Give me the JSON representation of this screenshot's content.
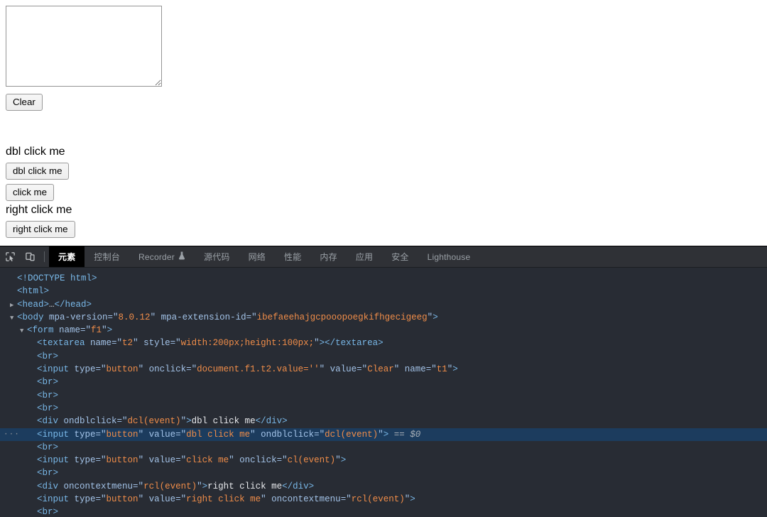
{
  "page": {
    "textarea": {
      "value": "",
      "placeholder": ""
    },
    "clear_button_label": "Clear",
    "dbl_click_text": "dbl click me",
    "dbl_click_button_label": "dbl click me",
    "click_button_label": "click me",
    "right_click_text": "right click me",
    "right_click_button_label": "right click me"
  },
  "devtools": {
    "icons": {
      "inspect": "inspect-element-icon",
      "device": "device-toolbar-icon"
    },
    "tabs": [
      {
        "label": "元素",
        "active": true,
        "icon": null
      },
      {
        "label": "控制台",
        "active": false,
        "icon": null
      },
      {
        "label": "Recorder",
        "active": false,
        "icon": "flask-icon"
      },
      {
        "label": "源代码",
        "active": false,
        "icon": null
      },
      {
        "label": "网络",
        "active": false,
        "icon": null
      },
      {
        "label": "性能",
        "active": false,
        "icon": null
      },
      {
        "label": "内存",
        "active": false,
        "icon": null
      },
      {
        "label": "应用",
        "active": false,
        "icon": null
      },
      {
        "label": "安全",
        "active": false,
        "icon": null
      },
      {
        "label": "Lighthouse",
        "active": false,
        "icon": null
      }
    ],
    "colors": {
      "panel_bg": "#282c34",
      "toolbar_bg": "#2f3136",
      "active_tab_bg": "#000000",
      "selected_row_bg": "#1c3c5e",
      "tag": "#79b8e8",
      "attr_name": "#a3c3e8",
      "attr_value": "#f08d49",
      "text_node": "#e8eaed"
    },
    "dom_lines": [
      {
        "indent": 0,
        "triangle": "none",
        "selected": false,
        "parts": [
          {
            "t": "tag",
            "s": "<!DOCTYPE html>"
          }
        ]
      },
      {
        "indent": 0,
        "triangle": "none",
        "selected": false,
        "parts": [
          {
            "t": "tag",
            "s": "<html>"
          }
        ]
      },
      {
        "indent": 0,
        "triangle": "collapsed",
        "selected": false,
        "parts": [
          {
            "t": "tag",
            "s": "<head>"
          },
          {
            "t": "dots",
            "s": "…"
          },
          {
            "t": "tag",
            "s": "</head>"
          }
        ]
      },
      {
        "indent": 0,
        "triangle": "expanded",
        "selected": false,
        "parts": [
          {
            "t": "tag",
            "s": "<body"
          },
          {
            "t": "attr",
            "s": " mpa-version"
          },
          {
            "t": "punc",
            "s": "=\""
          },
          {
            "t": "val",
            "s": "8.0.12"
          },
          {
            "t": "punc",
            "s": "\""
          },
          {
            "t": "attr",
            "s": " mpa-extension-id"
          },
          {
            "t": "punc",
            "s": "=\""
          },
          {
            "t": "val",
            "s": "ibefaeehajgcpooopoegkifhgecigeeg"
          },
          {
            "t": "punc",
            "s": "\""
          },
          {
            "t": "tag",
            "s": ">"
          }
        ]
      },
      {
        "indent": 1,
        "triangle": "expanded",
        "selected": false,
        "parts": [
          {
            "t": "tag",
            "s": "<form"
          },
          {
            "t": "attr",
            "s": " name"
          },
          {
            "t": "punc",
            "s": "=\""
          },
          {
            "t": "val",
            "s": "f1"
          },
          {
            "t": "punc",
            "s": "\""
          },
          {
            "t": "tag",
            "s": ">"
          }
        ]
      },
      {
        "indent": 2,
        "triangle": "none",
        "selected": false,
        "parts": [
          {
            "t": "tag",
            "s": "<textarea"
          },
          {
            "t": "attr",
            "s": " name"
          },
          {
            "t": "punc",
            "s": "=\""
          },
          {
            "t": "val",
            "s": "t2"
          },
          {
            "t": "punc",
            "s": "\""
          },
          {
            "t": "attr",
            "s": " style"
          },
          {
            "t": "punc",
            "s": "=\""
          },
          {
            "t": "val",
            "s": "width:200px;height:100px;"
          },
          {
            "t": "punc",
            "s": "\""
          },
          {
            "t": "tag",
            "s": "></textarea>"
          }
        ]
      },
      {
        "indent": 2,
        "triangle": "none",
        "selected": false,
        "parts": [
          {
            "t": "tag",
            "s": "<br>"
          }
        ]
      },
      {
        "indent": 2,
        "triangle": "none",
        "selected": false,
        "parts": [
          {
            "t": "tag",
            "s": "<input"
          },
          {
            "t": "attr",
            "s": " type"
          },
          {
            "t": "punc",
            "s": "=\""
          },
          {
            "t": "val",
            "s": "button"
          },
          {
            "t": "punc",
            "s": "\""
          },
          {
            "t": "attr",
            "s": " onclick"
          },
          {
            "t": "punc",
            "s": "=\""
          },
          {
            "t": "val",
            "s": "document.f1.t2.value=''"
          },
          {
            "t": "punc",
            "s": "\""
          },
          {
            "t": "attr",
            "s": " value"
          },
          {
            "t": "punc",
            "s": "=\""
          },
          {
            "t": "val",
            "s": "Clear"
          },
          {
            "t": "punc",
            "s": "\""
          },
          {
            "t": "attr",
            "s": " name"
          },
          {
            "t": "punc",
            "s": "=\""
          },
          {
            "t": "val",
            "s": "t1"
          },
          {
            "t": "punc",
            "s": "\""
          },
          {
            "t": "tag",
            "s": ">"
          }
        ]
      },
      {
        "indent": 2,
        "triangle": "none",
        "selected": false,
        "parts": [
          {
            "t": "tag",
            "s": "<br>"
          }
        ]
      },
      {
        "indent": 2,
        "triangle": "none",
        "selected": false,
        "parts": [
          {
            "t": "tag",
            "s": "<br>"
          }
        ]
      },
      {
        "indent": 2,
        "triangle": "none",
        "selected": false,
        "parts": [
          {
            "t": "tag",
            "s": "<br>"
          }
        ]
      },
      {
        "indent": 2,
        "triangle": "none",
        "selected": false,
        "parts": [
          {
            "t": "tag",
            "s": "<div"
          },
          {
            "t": "attr",
            "s": " ondblclick"
          },
          {
            "t": "punc",
            "s": "=\""
          },
          {
            "t": "val",
            "s": "dcl(event)"
          },
          {
            "t": "punc",
            "s": "\""
          },
          {
            "t": "tag",
            "s": ">"
          },
          {
            "t": "txt",
            "s": "dbl click me"
          },
          {
            "t": "tag",
            "s": "</div>"
          }
        ]
      },
      {
        "indent": 2,
        "triangle": "none",
        "selected": true,
        "badge": "···",
        "parts": [
          {
            "t": "tag",
            "s": "<input"
          },
          {
            "t": "attr",
            "s": " type"
          },
          {
            "t": "punc",
            "s": "=\""
          },
          {
            "t": "val",
            "s": "button"
          },
          {
            "t": "punc",
            "s": "\""
          },
          {
            "t": "attr",
            "s": " value"
          },
          {
            "t": "punc",
            "s": "=\""
          },
          {
            "t": "val",
            "s": "dbl click me"
          },
          {
            "t": "punc",
            "s": "\""
          },
          {
            "t": "attr",
            "s": " ondblclick"
          },
          {
            "t": "punc",
            "s": "=\""
          },
          {
            "t": "val",
            "s": "dcl(event)"
          },
          {
            "t": "punc",
            "s": "\""
          },
          {
            "t": "tag",
            "s": ">"
          },
          {
            "t": "eqeq",
            "s": " == "
          },
          {
            "t": "dollr",
            "s": "$0"
          }
        ]
      },
      {
        "indent": 2,
        "triangle": "none",
        "selected": false,
        "parts": [
          {
            "t": "tag",
            "s": "<br>"
          }
        ]
      },
      {
        "indent": 2,
        "triangle": "none",
        "selected": false,
        "parts": [
          {
            "t": "tag",
            "s": "<input"
          },
          {
            "t": "attr",
            "s": " type"
          },
          {
            "t": "punc",
            "s": "=\""
          },
          {
            "t": "val",
            "s": "button"
          },
          {
            "t": "punc",
            "s": "\""
          },
          {
            "t": "attr",
            "s": " value"
          },
          {
            "t": "punc",
            "s": "=\""
          },
          {
            "t": "val",
            "s": "click me"
          },
          {
            "t": "punc",
            "s": "\""
          },
          {
            "t": "attr",
            "s": " onclick"
          },
          {
            "t": "punc",
            "s": "=\""
          },
          {
            "t": "val",
            "s": "cl(event)"
          },
          {
            "t": "punc",
            "s": "\""
          },
          {
            "t": "tag",
            "s": ">"
          }
        ]
      },
      {
        "indent": 2,
        "triangle": "none",
        "selected": false,
        "parts": [
          {
            "t": "tag",
            "s": "<br>"
          }
        ]
      },
      {
        "indent": 2,
        "triangle": "none",
        "selected": false,
        "parts": [
          {
            "t": "tag",
            "s": "<div"
          },
          {
            "t": "attr",
            "s": " oncontextmenu"
          },
          {
            "t": "punc",
            "s": "=\""
          },
          {
            "t": "val",
            "s": "rcl(event)"
          },
          {
            "t": "punc",
            "s": "\""
          },
          {
            "t": "tag",
            "s": ">"
          },
          {
            "t": "txt",
            "s": "right click me"
          },
          {
            "t": "tag",
            "s": "</div>"
          }
        ]
      },
      {
        "indent": 2,
        "triangle": "none",
        "selected": false,
        "parts": [
          {
            "t": "tag",
            "s": "<input"
          },
          {
            "t": "attr",
            "s": " type"
          },
          {
            "t": "punc",
            "s": "=\""
          },
          {
            "t": "val",
            "s": "button"
          },
          {
            "t": "punc",
            "s": "\""
          },
          {
            "t": "attr",
            "s": " value"
          },
          {
            "t": "punc",
            "s": "=\""
          },
          {
            "t": "val",
            "s": "right click me"
          },
          {
            "t": "punc",
            "s": "\""
          },
          {
            "t": "attr",
            "s": " oncontextmenu"
          },
          {
            "t": "punc",
            "s": "=\""
          },
          {
            "t": "val",
            "s": "rcl(event)"
          },
          {
            "t": "punc",
            "s": "\""
          },
          {
            "t": "tag",
            "s": ">"
          }
        ]
      },
      {
        "indent": 2,
        "triangle": "none",
        "selected": false,
        "parts": [
          {
            "t": "tag",
            "s": "<br>"
          }
        ]
      }
    ]
  }
}
